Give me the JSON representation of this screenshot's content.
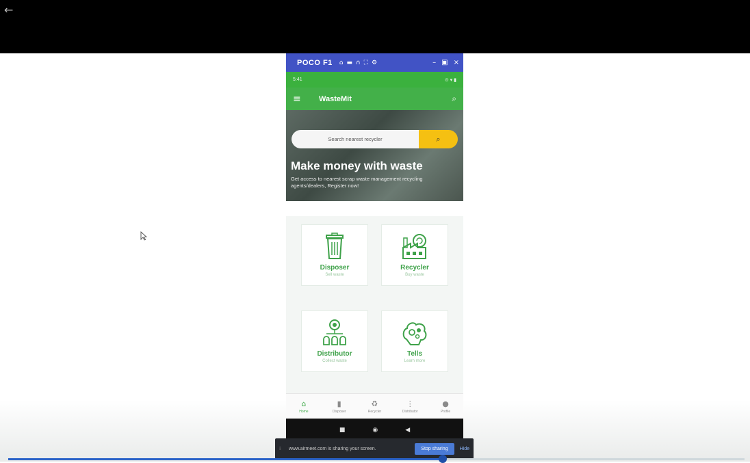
{
  "window": {
    "device_name": "POCO F1",
    "toolbar_icons": [
      "home-icon",
      "camera-icon",
      "headset-icon",
      "fullscreen-icon",
      "settings-icon"
    ],
    "minimize": "–",
    "close": "×"
  },
  "phone_status": {
    "time": "5:41",
    "right": "⊙ ▾ ▮"
  },
  "app": {
    "title": "WasteMit",
    "search_placeholder": "Search nearest recycler",
    "hero_title": "Make money with waste",
    "hero_subtitle": "Get access to nearest scrap waste management recycling agents/dealers, Register now!"
  },
  "cards": [
    {
      "label": "Disposer",
      "sub": "Sell waste",
      "icon": "trash-bin-icon"
    },
    {
      "label": "Recycler",
      "sub": "Buy waste",
      "icon": "recycling-factory-icon"
    },
    {
      "label": "Distributor",
      "sub": "Collect waste",
      "icon": "distributor-icon"
    },
    {
      "label": "Tells",
      "sub": "Learn more",
      "icon": "brain-gears-icon"
    }
  ],
  "bottom_nav": [
    {
      "label": "Home",
      "icon": "⌂"
    },
    {
      "label": "Disposer",
      "icon": "▮"
    },
    {
      "label": "Recycler",
      "icon": "♻"
    },
    {
      "label": "Distributor",
      "icon": "⋮"
    },
    {
      "label": "Profile",
      "icon": "●"
    }
  ],
  "system_nav": {
    "recent": "■",
    "home": "◉",
    "back": "◀"
  },
  "share_bar": {
    "grip": "⁞",
    "message": "www.airmeet.com is sharing your screen.",
    "stop_label": "Stop sharing",
    "hide_label": "Hide"
  },
  "video": {
    "progress": 0.59
  },
  "colors": {
    "appbar": "#43b049",
    "window_titlebar": "#4153c5",
    "search_button": "#f5c012",
    "accent_green": "#3fa24a"
  }
}
